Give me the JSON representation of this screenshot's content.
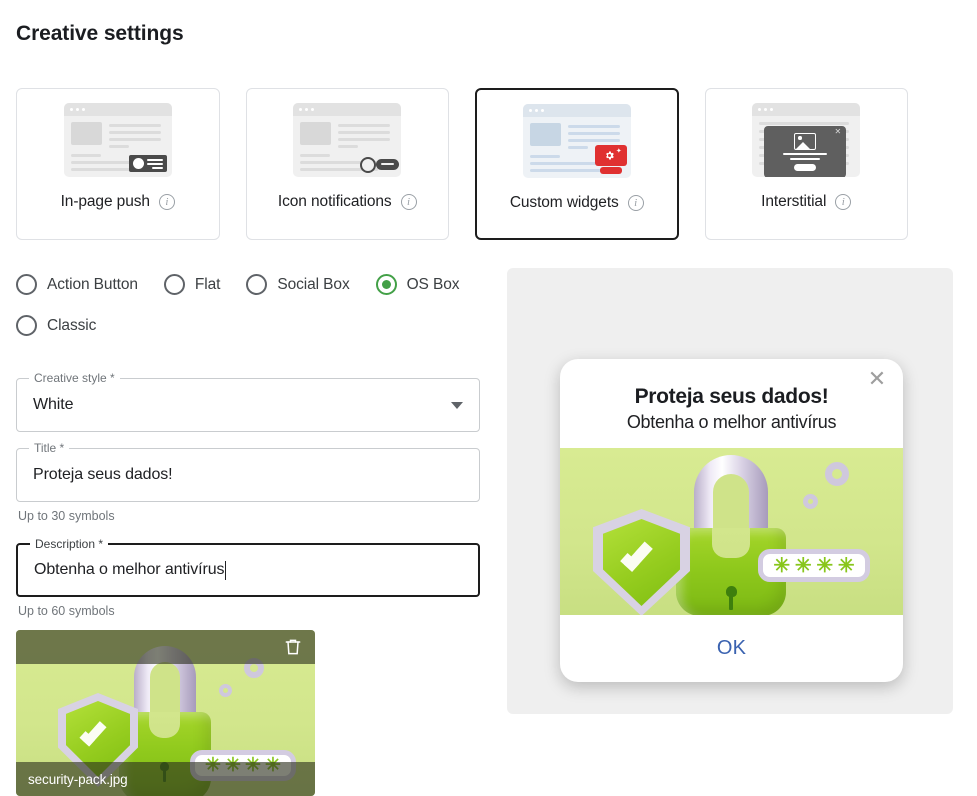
{
  "page": {
    "title": "Creative settings"
  },
  "format_cards": [
    {
      "label": "In-page push",
      "icon": "in-page-push-icon",
      "info_icon": "info-icon",
      "selected": false
    },
    {
      "label": "Icon notifications",
      "icon": "icon-notifications-icon",
      "info_icon": "info-icon",
      "selected": false
    },
    {
      "label": "Custom widgets",
      "icon": "custom-widgets-icon",
      "info_icon": "info-icon",
      "selected": true
    },
    {
      "label": "Interstitial",
      "icon": "interstitial-icon",
      "info_icon": "info-icon",
      "selected": false
    }
  ],
  "widget_types": {
    "row1": [
      {
        "label": "Action Button",
        "selected": false
      },
      {
        "label": "Flat",
        "selected": false
      },
      {
        "label": "Social Box",
        "selected": false
      },
      {
        "label": "OS Box",
        "selected": true
      }
    ],
    "row2": [
      {
        "label": "Classic",
        "selected": false
      }
    ]
  },
  "form": {
    "creative_style": {
      "legend": "Creative style *",
      "value": "White",
      "arrow_icon": "chevron-down-icon"
    },
    "title": {
      "legend": "Title *",
      "value": "Proteja seus dados!",
      "helper": "Up to 30 symbols"
    },
    "description": {
      "legend": "Description *",
      "value": "Obtenha o melhor antivírus",
      "helper": "Up to 60 symbols",
      "focused": true
    }
  },
  "thumbnail": {
    "filename": "security-pack.jpg",
    "delete_icon": "trash-icon"
  },
  "preview": {
    "title": "Proteja seus dados!",
    "description": "Obtenha o melhor antivírus",
    "ok_label": "OK",
    "close_icon": "close-icon",
    "image_alt": "security-padlock-shield-illustration"
  },
  "colors": {
    "accent_green": "#43a047",
    "selected_border": "#1d1d1d",
    "ok_blue": "#3a62b0",
    "widget_red": "#e03131",
    "panel_bg": "#efefef",
    "helper_text": "#70757a"
  }
}
